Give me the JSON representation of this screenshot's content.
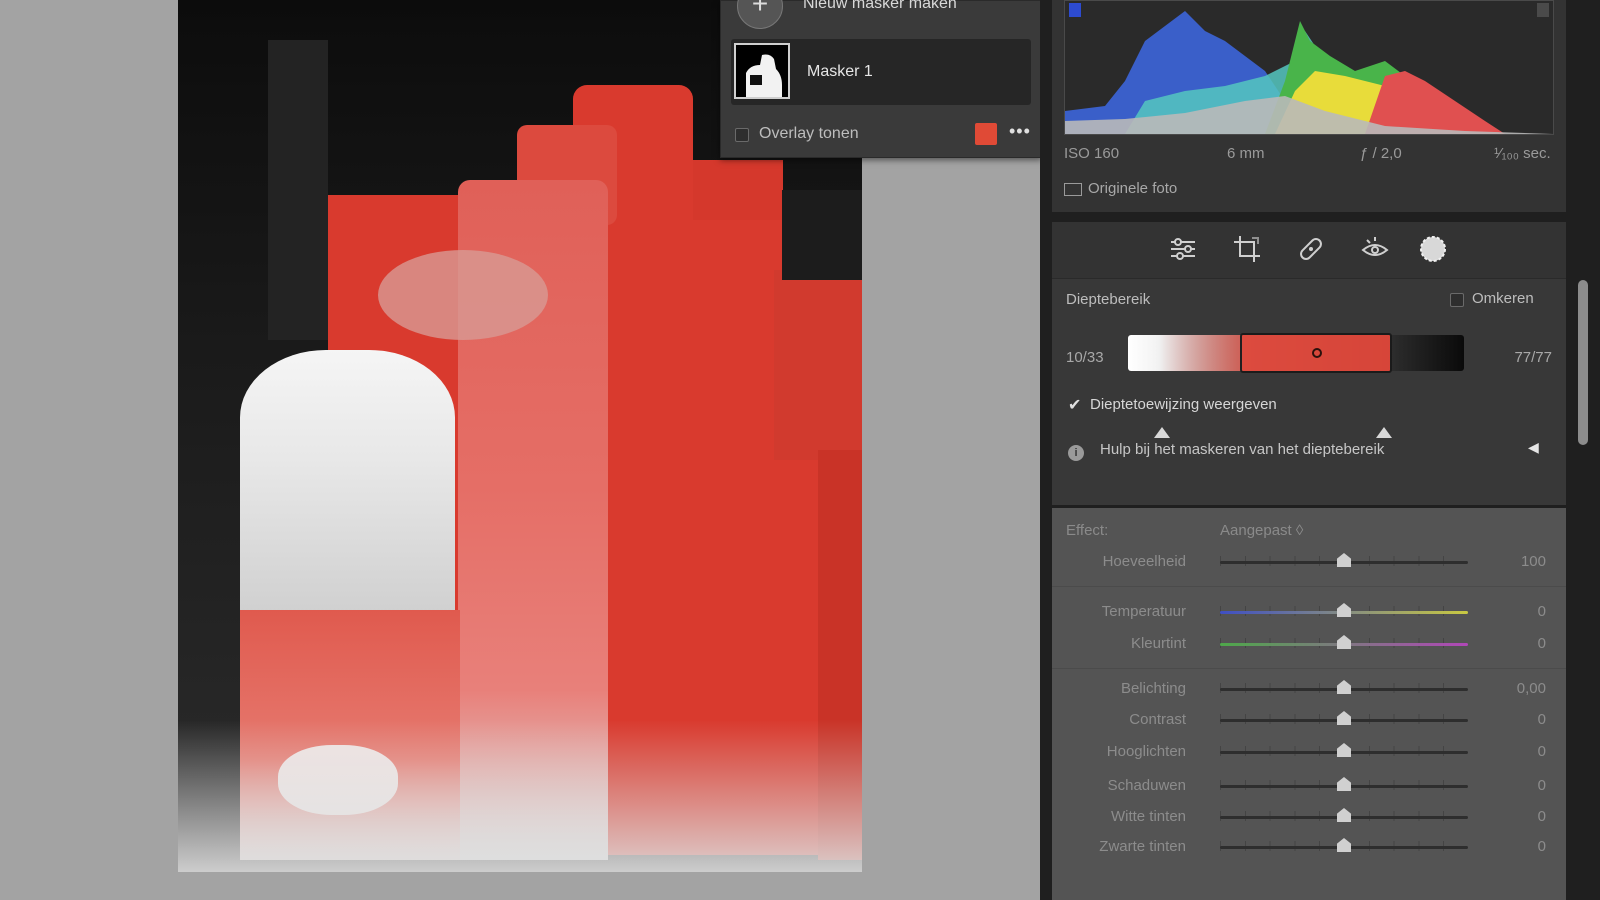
{
  "mask_panel": {
    "new_mask_label": "Nieuw masker maken",
    "new_mask_button_glyph": "+",
    "mask_name": "Masker 1",
    "overlay_label": "Overlay tonen",
    "overlay_color": "#e04a36",
    "more_glyph": "•••"
  },
  "histogram_panel": {
    "iso": "ISO 160",
    "focal": "6 mm",
    "aperture": "ƒ / 2,0",
    "shutter": "¹⁄₁₀₀ sec.",
    "original_photo_label": "Originele foto"
  },
  "tools": [
    "edit-sliders-icon",
    "crop-icon",
    "healing-bandage-icon",
    "red-eye-icon",
    "masking-icon"
  ],
  "depth_range": {
    "title": "Dieptebereik",
    "invert_label": "Omkeren",
    "min_value": "10/33",
    "max_value": "77/77",
    "show_mapping_label": "Dieptetoewijzing weergeven",
    "show_mapping_checked": true,
    "help_label": "Hulp bij het maskeren van het dieptebereik",
    "selection_start_fraction": 0.1,
    "selection_end_fraction": 0.77
  },
  "effect": {
    "label": "Effect:",
    "value": "Aangepast ◊",
    "sliders": [
      {
        "label": "Hoeveelheid",
        "value": "100",
        "position": 0.5,
        "track": "neutral"
      },
      {
        "label": "Temperatuur",
        "value": "0",
        "position": 0.5,
        "track": "temperature"
      },
      {
        "label": "Kleurtint",
        "value": "0",
        "position": 0.5,
        "track": "tint"
      },
      {
        "label": "Belichting",
        "value": "0,00",
        "position": 0.5,
        "track": "neutral"
      },
      {
        "label": "Contrast",
        "value": "0",
        "position": 0.5,
        "track": "neutral"
      },
      {
        "label": "Hooglichten",
        "value": "0",
        "position": 0.5,
        "track": "neutral"
      },
      {
        "label": "Schaduwen",
        "value": "0",
        "position": 0.5,
        "track": "neutral"
      },
      {
        "label": "Witte tinten",
        "value": "0",
        "position": 0.5,
        "track": "neutral"
      },
      {
        "label": "Zwarte tinten",
        "value": "0",
        "position": 0.5,
        "track": "neutral"
      }
    ]
  }
}
